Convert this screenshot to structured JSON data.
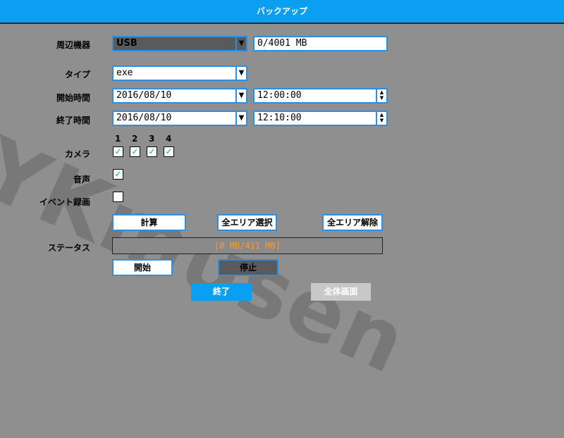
{
  "title": "バックアップ",
  "watermark": "YKmusen",
  "device": {
    "label": "周辺機器",
    "value": "USB",
    "capacity": "0/4001 MB"
  },
  "type": {
    "label": "タイプ",
    "value": "exe"
  },
  "start": {
    "label": "開始時間",
    "date": "2016/08/10",
    "time": "12:00:00"
  },
  "end": {
    "label": "終了時間",
    "date": "2016/08/10",
    "time": "12:10:00"
  },
  "camera": {
    "label": "カメラ",
    "channels": [
      "1",
      "2",
      "3",
      "4"
    ],
    "checked": [
      true,
      true,
      true,
      true
    ]
  },
  "audio": {
    "label": "音声",
    "checked": true
  },
  "event": {
    "label": "イベント録画",
    "checked": false
  },
  "buttons": {
    "calc": "計算",
    "select_all": "全エリア選択",
    "deselect_all": "全エリア解除",
    "start": "開始",
    "stop": "停止",
    "exit": "終了",
    "fullscreen": "全体画面"
  },
  "status": {
    "label": "ステータス",
    "value": "[0 MB/411 MB]"
  },
  "icons": {
    "dropdown": "▼",
    "spin_up": "▲",
    "spin_down": "▼",
    "check": "✓"
  },
  "colors": {
    "accent": "#0a9ff0",
    "status_text": "#f59a3c"
  }
}
